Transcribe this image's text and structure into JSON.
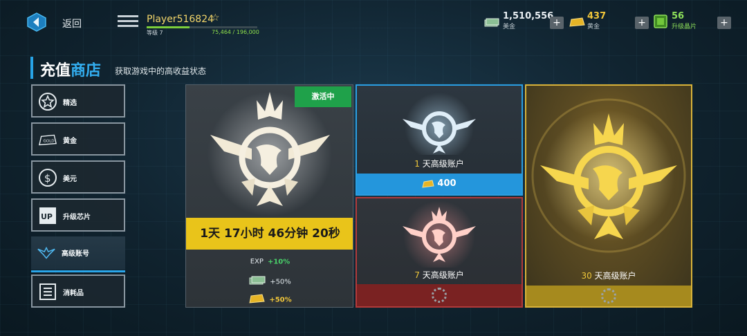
{
  "topbar": {
    "back_label": "返回",
    "player_name": "Player516824",
    "level_label": "等级 7",
    "level_xp": "75,464 / 196,000",
    "level_progress": 0.385
  },
  "currencies": [
    {
      "icon": "cash-icon",
      "value": "1,510,556",
      "label": "美金"
    },
    {
      "icon": "gold-bar-icon",
      "value": "437",
      "label": "黄金"
    },
    {
      "icon": "upgrade-chip-icon",
      "value": "56",
      "label": "升级晶片"
    }
  ],
  "plus_label": "+",
  "title": {
    "part1": "充值",
    "part2": "商店",
    "subtitle": "获取游戏中的高收益状态"
  },
  "sidebar": {
    "items": [
      {
        "label": "精选",
        "icon": "star-badge-icon"
      },
      {
        "label": "黄金",
        "icon": "gold-icon"
      },
      {
        "label": "美元",
        "icon": "dollar-icon"
      },
      {
        "label": "升级芯片",
        "icon": "up-chip-icon"
      },
      {
        "label": "高级账号",
        "icon": "premium-eagle-icon",
        "active": true
      },
      {
        "label": "消耗品",
        "icon": "consumable-icon"
      }
    ],
    "up_text": "UP",
    "gold_text": "GOLD",
    "dollar_text": "$"
  },
  "main_card": {
    "tag": "激活中",
    "timer": "1天 17小时 46分钟 20秒",
    "bonuses": [
      {
        "icon": "exp-icon",
        "icon_text": "EXP",
        "value": "+10%"
      },
      {
        "icon": "cash-icon",
        "value": "+50%"
      },
      {
        "icon": "gold-bar-icon",
        "value": "+50%"
      }
    ]
  },
  "card_1d": {
    "days": "1",
    "label": "天高级账户",
    "price": "400"
  },
  "card_7d": {
    "days": "7",
    "label": "天高级账户"
  },
  "card_30d": {
    "days": "30",
    "label": "天高级账户"
  },
  "colors": {
    "accent": "#2aa6ea",
    "gold": "#e9c41a",
    "active_green": "#1fa14a",
    "red": "#b23a3a"
  }
}
